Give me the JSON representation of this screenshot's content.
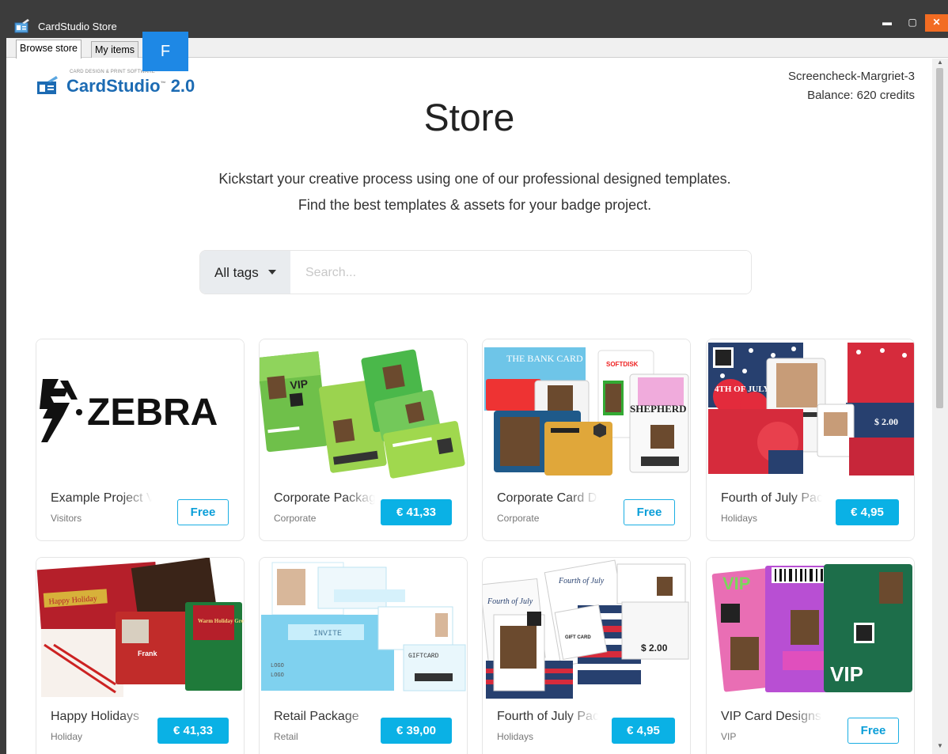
{
  "window": {
    "title": "CardStudio Store",
    "controls": {
      "minimize": "▬",
      "maximize": "▢",
      "close": "✕"
    }
  },
  "tabs": [
    {
      "label": "Browse store",
      "active": true
    },
    {
      "label": "My items",
      "active": false
    }
  ],
  "overlay_badge": "F",
  "header": {
    "logo_text": "CardStudio",
    "logo_version": "2.0",
    "logo_tagline": "CARD DESIGN & PRINT SOFTWARE",
    "user_name": "Screencheck-Margriet-3",
    "balance": "Balance: 620 credits"
  },
  "hero": {
    "title": "Store",
    "subtitle_line1": "Kickstart your creative process using one of our professional designed templates.",
    "subtitle_line2": "Find the best templates & assets for your badge project."
  },
  "search": {
    "tags_label": "All tags",
    "placeholder": "Search..."
  },
  "products": [
    {
      "title": "Example Project Visitors",
      "tag": "Visitors",
      "price": "Free",
      "free": true
    },
    {
      "title": "Corporate Package",
      "tag": "Corporate",
      "price": "€ 41,33",
      "free": false
    },
    {
      "title": "Corporate Card Designs",
      "tag": "Corporate",
      "price": "Free",
      "free": true
    },
    {
      "title": "Fourth of July Package",
      "tag": "Holidays",
      "price": "€ 4,95",
      "free": false
    },
    {
      "title": "Happy Holidays",
      "tag": "Holiday",
      "price": "€ 41,33",
      "free": false
    },
    {
      "title": "Retail Package",
      "tag": "Retail",
      "price": "€ 39,00",
      "free": false
    },
    {
      "title": "Fourth of July Package",
      "tag": "Holidays",
      "price": "€ 4,95",
      "free": false
    },
    {
      "title": "VIP Card Designs Logan",
      "tag": "VIP",
      "price": "Free",
      "free": true
    }
  ],
  "thumbnail_text": {
    "zebra": "ZEBRA",
    "vip": "VIP",
    "bank": "THE BANK CARD",
    "softdisk": "SOFTDISK",
    "shepherd": "SHEPHERD",
    "july": "4TH OF JULY",
    "july_price": "$ 2.00",
    "happy": "Happy Holiday",
    "warm": "Warm Holiday Greeting!",
    "frank": "Frank",
    "invite": "INVITE",
    "logo": "LOGO",
    "giftcard": "GIFTCARD",
    "fourth": "Fourth of July",
    "gift": "GIFT CARD",
    "vip2": "VIP"
  },
  "colors": {
    "accent": "#0ab1e5",
    "brand": "#1c6bb3",
    "titlebar": "#3c3c3c",
    "close": "#f26c22",
    "badge": "#1e88e5"
  }
}
